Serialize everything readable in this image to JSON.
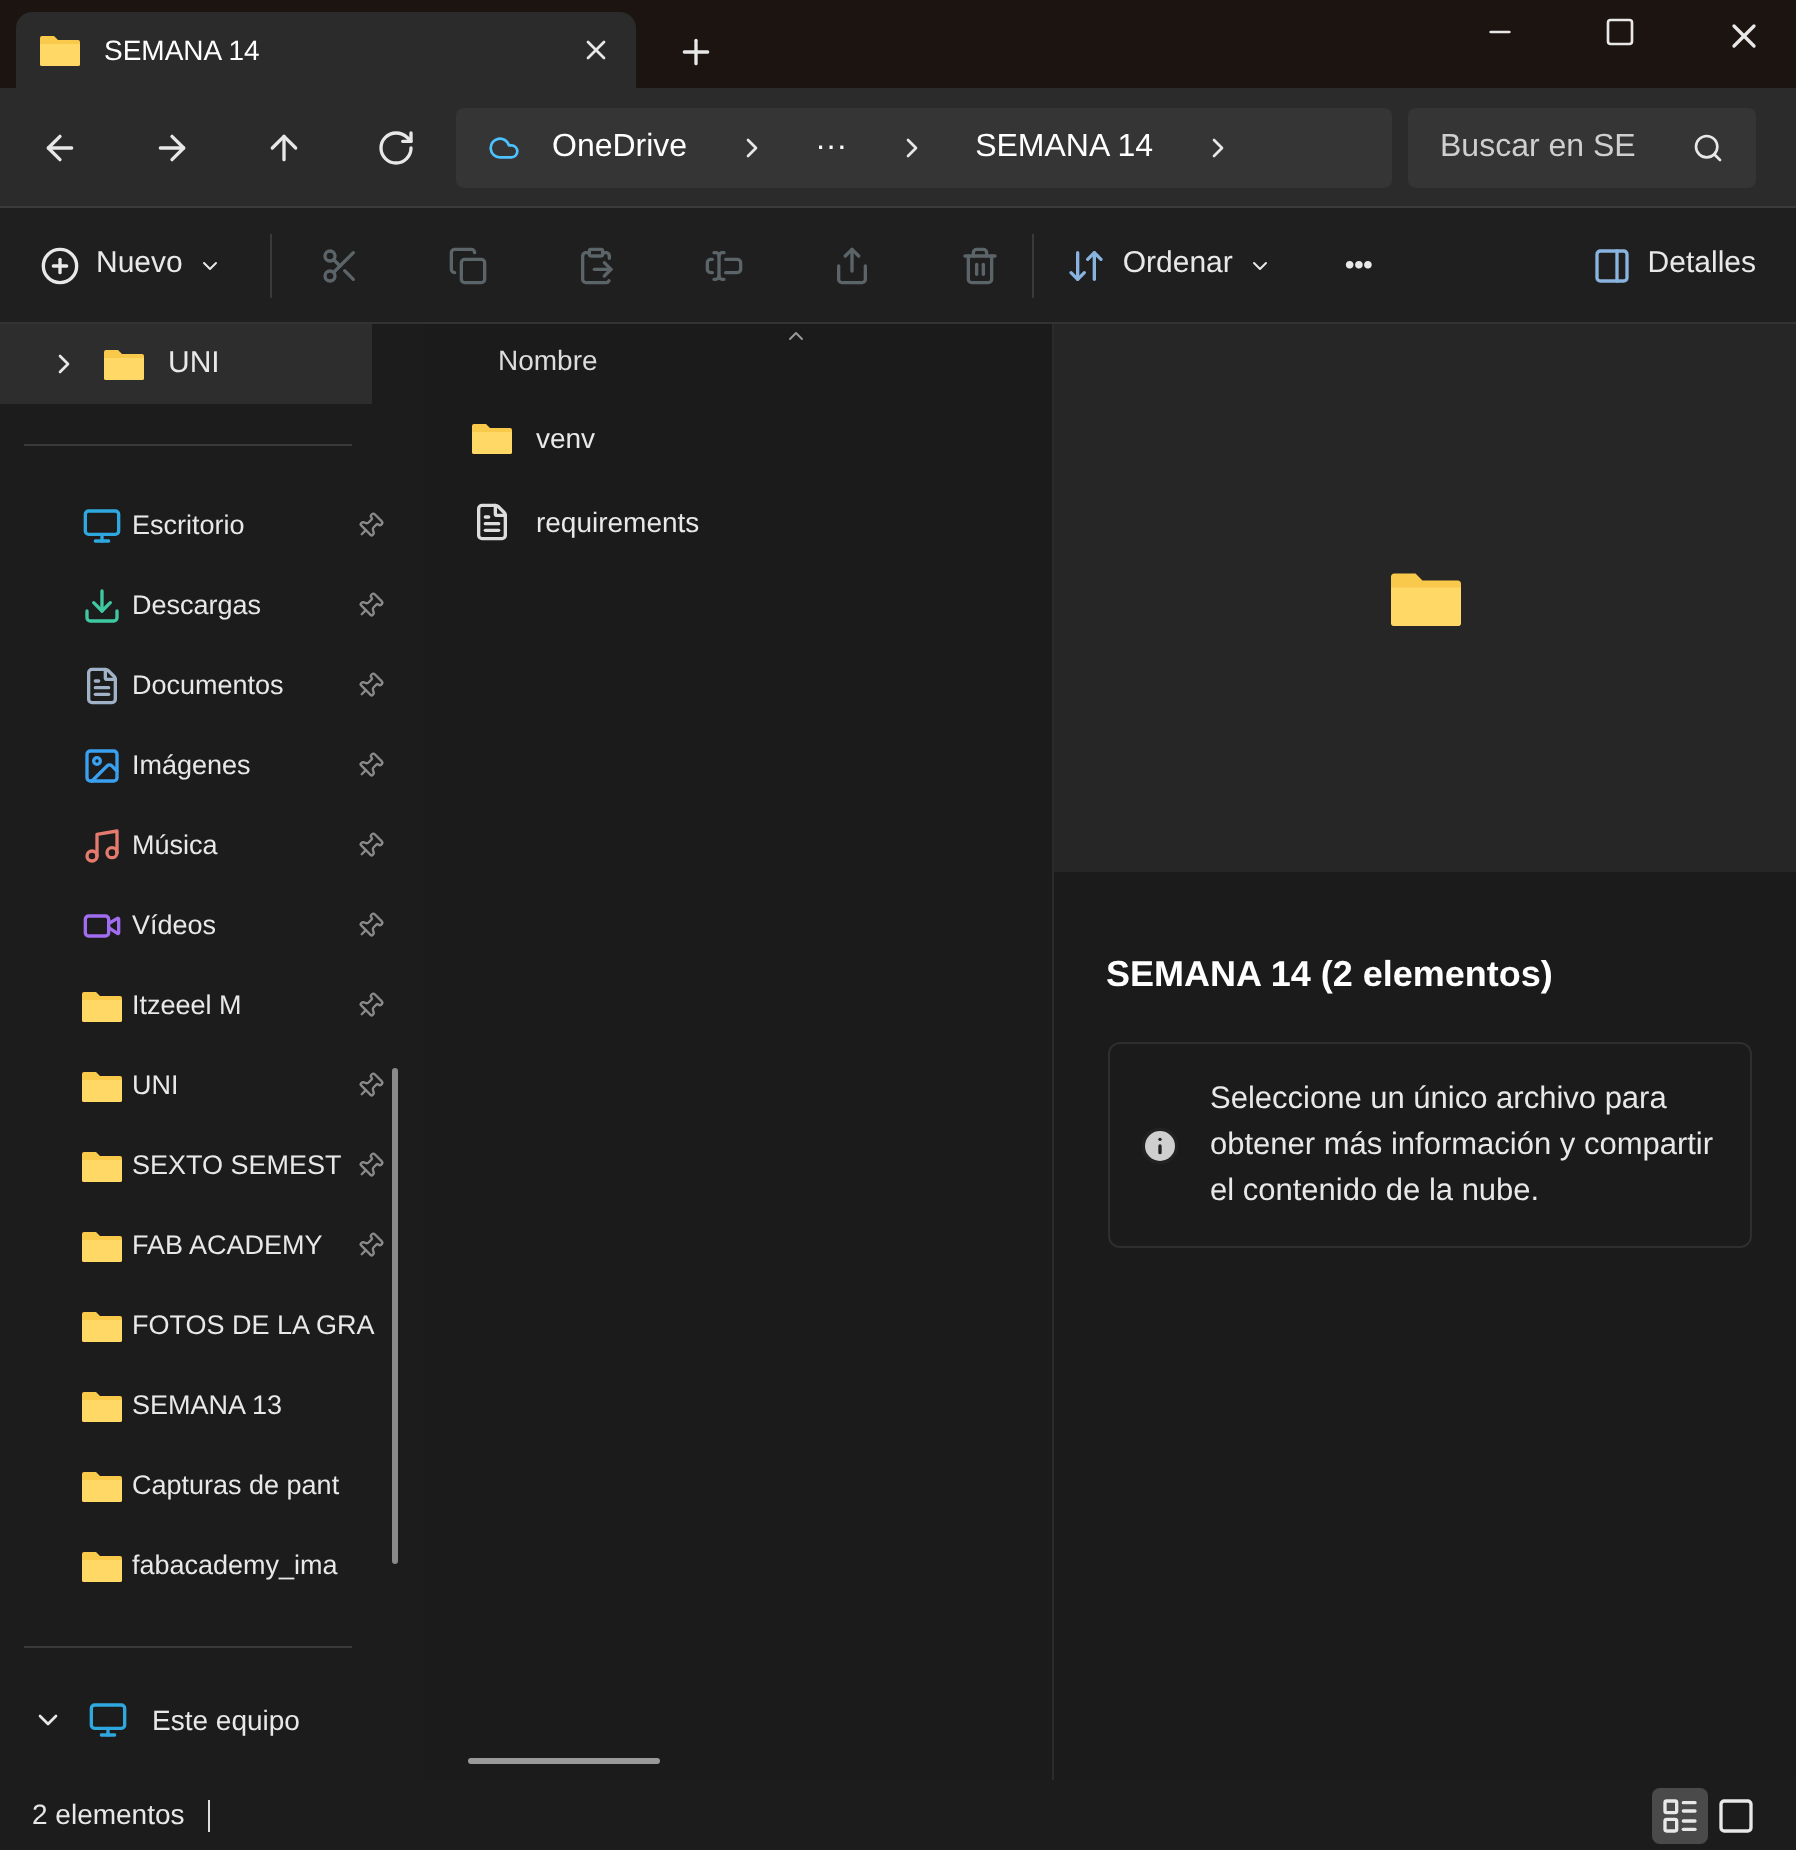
{
  "window": {
    "tab_title": "SEMANA 14"
  },
  "address_bar": {
    "breadcrumbs": [
      "OneDrive",
      "···",
      "SEMANA 14"
    ],
    "search": {
      "placeholder": "Buscar en SE"
    }
  },
  "toolbar": {
    "new_label": "Nuevo",
    "sort_label": "Ordenar",
    "more_label": "•••",
    "details_label": "Detalles",
    "actions": [
      {
        "kind": "cut",
        "disabled": true
      },
      {
        "kind": "copy",
        "disabled": true
      },
      {
        "kind": "paste",
        "disabled": true
      },
      {
        "kind": "rename",
        "disabled": true
      },
      {
        "kind": "share",
        "disabled": true
      },
      {
        "kind": "delete",
        "disabled": true
      }
    ]
  },
  "sidebar": {
    "top_item": {
      "label": "UNI",
      "selected": true
    },
    "quick_access": [
      {
        "label": "Escritorio",
        "kind": "desktop",
        "pinned": true
      },
      {
        "label": "Descargas",
        "kind": "downloads",
        "pinned": true
      },
      {
        "label": "Documentos",
        "kind": "documents",
        "pinned": true
      },
      {
        "label": "Imágenes",
        "kind": "pictures",
        "pinned": true
      },
      {
        "label": "Música",
        "kind": "music",
        "pinned": true
      },
      {
        "label": "Vídeos",
        "kind": "videos",
        "pinned": true
      },
      {
        "label": "Itzeeel M",
        "kind": "folder",
        "pinned": true
      },
      {
        "label": "UNI",
        "kind": "folder",
        "pinned": true
      },
      {
        "label": "SEXTO SEMEST",
        "kind": "folder",
        "pinned": true
      },
      {
        "label": "FAB ACADEMY",
        "kind": "folder",
        "pinned": true
      },
      {
        "label": "FOTOS DE LA GRA",
        "kind": "folder",
        "pinned": false
      },
      {
        "label": "SEMANA 13",
        "kind": "folder",
        "pinned": false
      },
      {
        "label": "Capturas de pant",
        "kind": "folder",
        "pinned": false
      },
      {
        "label": "fabacademy_ima",
        "kind": "folder",
        "pinned": false
      }
    ],
    "this_pc": {
      "label": "Este equipo",
      "expanded": true
    }
  },
  "file_list": {
    "column": "Nombre",
    "files": [
      {
        "name": "venv",
        "kind": "folder"
      },
      {
        "name": "requirements",
        "kind": "text"
      }
    ]
  },
  "details_pane": {
    "title": "SEMANA 14 (2 elementos)",
    "info": "Seleccione un único archivo para obtener más información y compartir el contenido de la nube."
  },
  "status_bar": {
    "count": "2 elementos",
    "views": [
      {
        "kind": "details",
        "selected": true
      },
      {
        "kind": "tiles",
        "selected": false
      }
    ]
  }
}
